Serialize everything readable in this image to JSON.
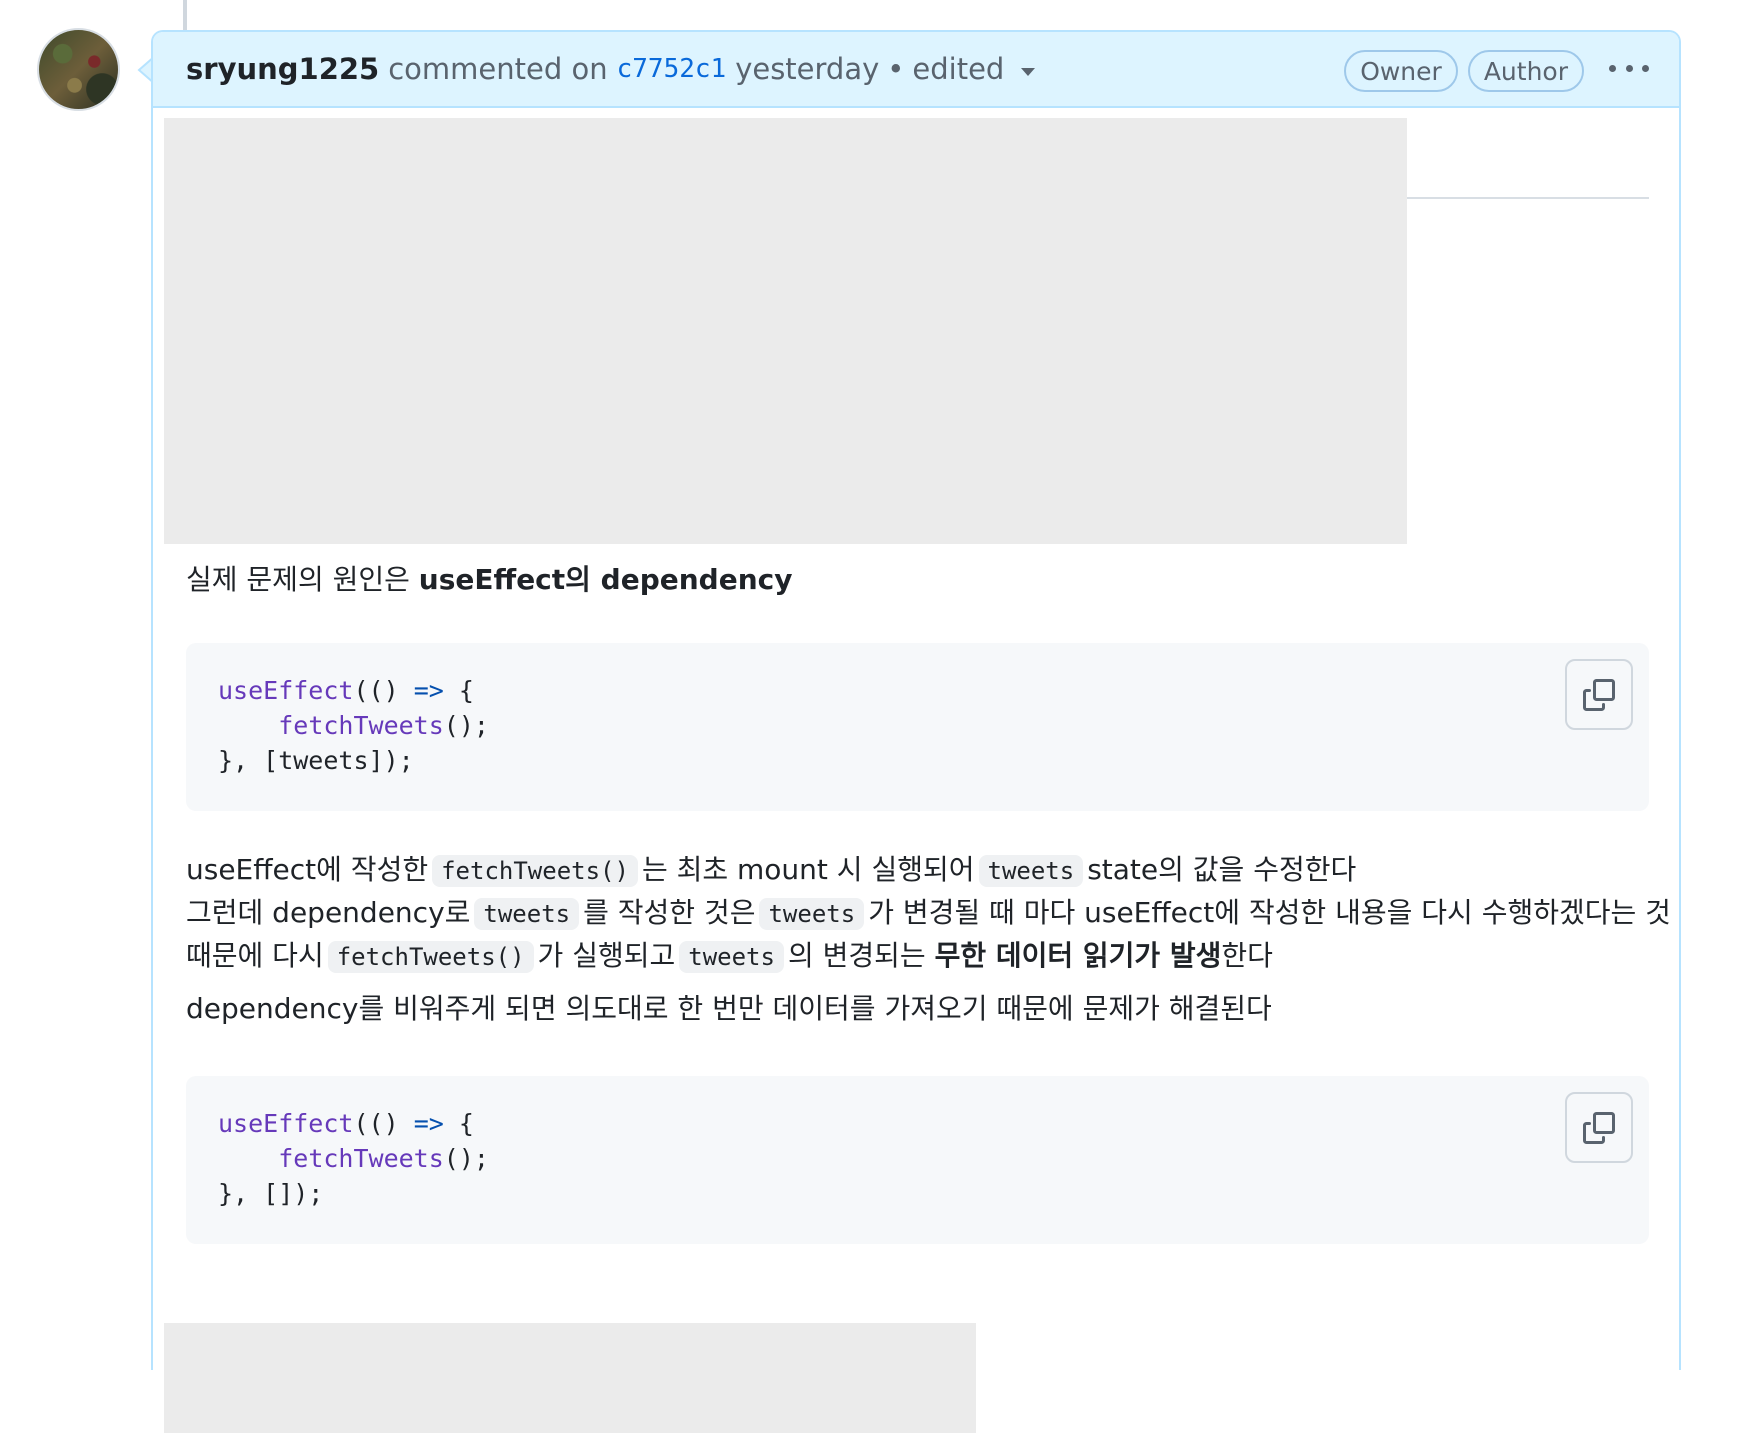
{
  "comment": {
    "author": "sryung1225",
    "action": "commented on",
    "commit_sha": "c7752c1",
    "time": "yesterday",
    "separator": "•",
    "edited_label": "edited",
    "badges": [
      "Owner",
      "Author"
    ]
  },
  "body": {
    "p1_prefix": "실제 문제의 원인은 ",
    "p1_bold": "useEffect의 dependency",
    "code1": {
      "line1_fn": "useEffect",
      "line1_rest1": "(() ",
      "line1_op": "=>",
      "line1_rest2": " {",
      "line2_indent": "    ",
      "line2_fn": "fetchTweets",
      "line2_rest": "();",
      "line3": "}, [tweets]);"
    },
    "p2": {
      "l1_a": "useEffect에 작성한",
      "l1_code1": "fetchTweets()",
      "l1_b": "는 최초 mount 시 실행되어",
      "l1_code2": "tweets",
      "l1_c": "state의 값을 수정한다",
      "l2_a": "그런데 dependency로",
      "l2_code1": "tweets",
      "l2_b": "를 작성한 것은",
      "l2_code2": "tweets",
      "l2_c": "가 변경될 때 마다 useEffect에 작성한 내용을 다시 수행하겠다는 것",
      "l3_a": "때문에 다시",
      "l3_code1": "fetchTweets()",
      "l3_b": "가 실행되고",
      "l3_code2": "tweets",
      "l3_c": "의 변경되는 ",
      "l3_bold": "무한 데이터 읽기가 발생",
      "l3_d": "한다"
    },
    "p3": "dependency를 비워주게 되면 의도대로 한 번만 데이터를 가져오기 때문에 문제가 해결된다",
    "code2": {
      "line1_fn": "useEffect",
      "line1_rest1": "(() ",
      "line1_op": "=>",
      "line1_rest2": " {",
      "line2_indent": "    ",
      "line2_fn": "fetchTweets",
      "line2_rest": "();",
      "line3": "}, []);"
    }
  },
  "icons": {
    "copy": "copy-icon",
    "caret": "triangle-down-icon",
    "kebab": "kebab-horizontal-icon"
  },
  "colors": {
    "header_bg": "#ddf4ff",
    "header_border": "#b6e3ff",
    "link": "#0969da",
    "code_fn": "#6639ba",
    "code_op": "#0550ae"
  }
}
